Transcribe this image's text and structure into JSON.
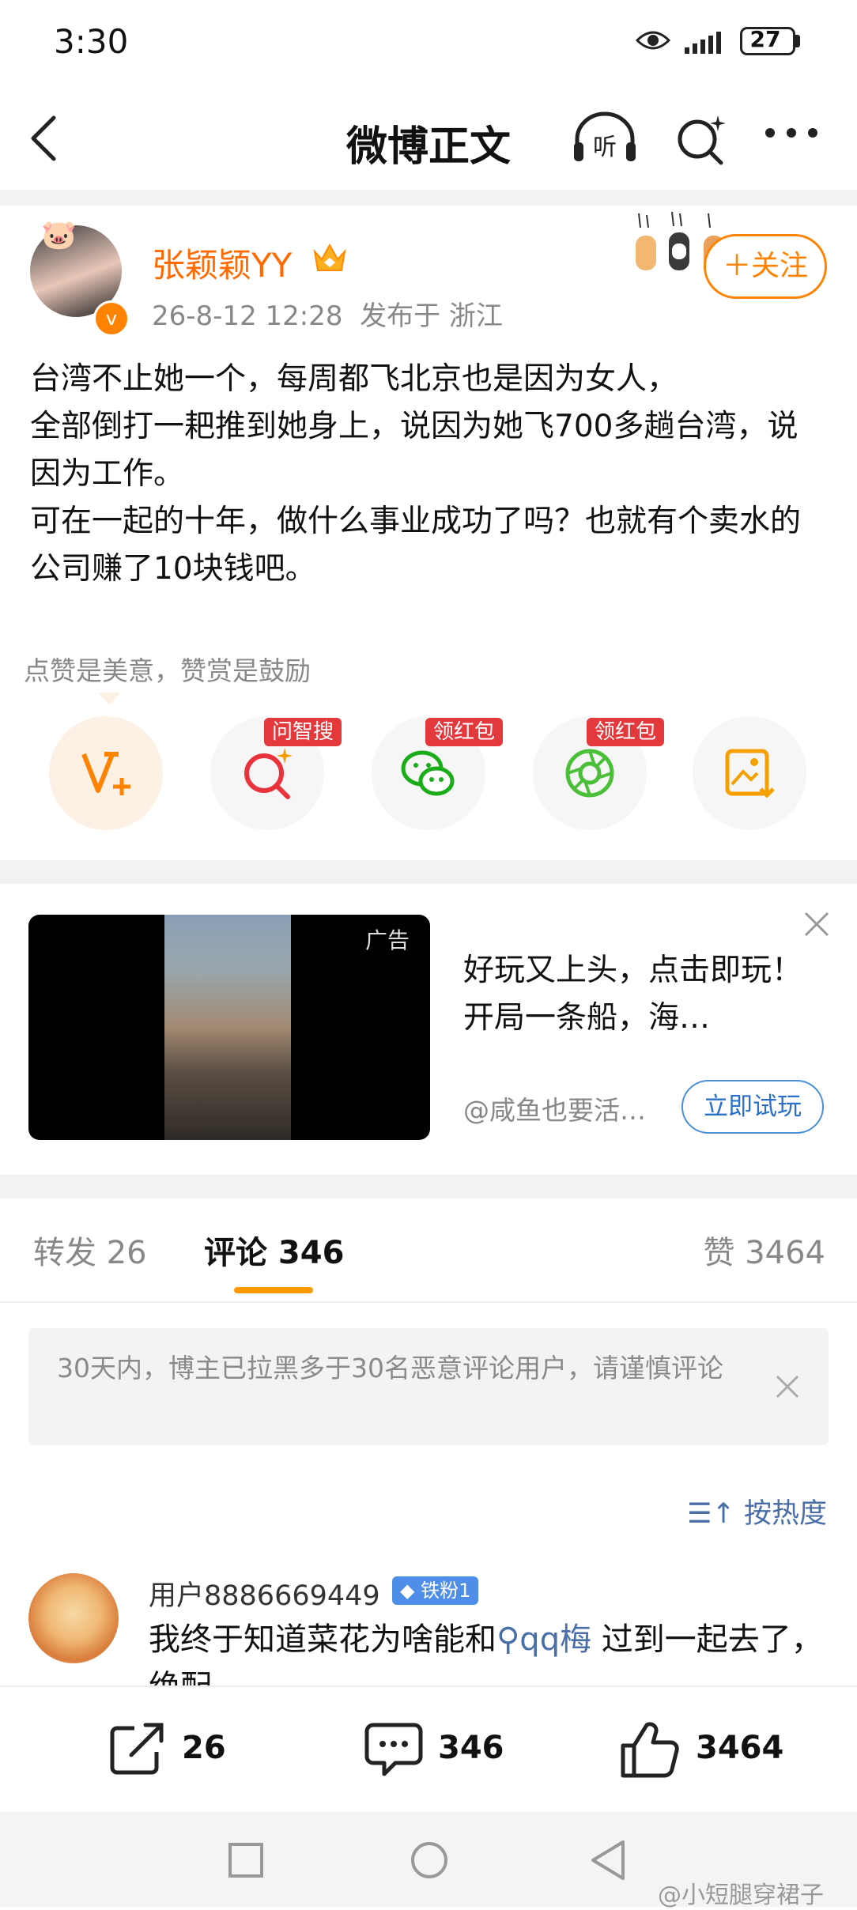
{
  "status_bar": {
    "time": "3:30",
    "battery": "27"
  },
  "nav": {
    "title": "微博正文",
    "listen_label": "听"
  },
  "post": {
    "author": "张颖颖YY",
    "meta": "26-8-12 12:28  发布于 浙江",
    "follow_label": "＋关注",
    "text": "台湾不止她一个，每周都飞北京也是因为女人，\n全部倒打一耙推到她身上，说因为她飞700多趟台湾，说因为工作。\n可在一起的十年，做什么事业成功了吗？也就有个卖水的公司赚了10块钱吧。",
    "tip": "点赞是美意，赞赏是鼓励",
    "actions": [
      {
        "icon": "v-plus-icon",
        "badge": ""
      },
      {
        "icon": "ai-search-icon",
        "badge": "问智搜"
      },
      {
        "icon": "wechat-icon",
        "badge": "领红包"
      },
      {
        "icon": "moments-icon",
        "badge": "领红包"
      },
      {
        "icon": "save-image-icon",
        "badge": ""
      }
    ]
  },
  "ad": {
    "label": "广告",
    "title": "好玩又上头，点击即玩！开局一条船，海…",
    "source": "@咸鱼也要活…",
    "button": "立即试玩"
  },
  "tabs": {
    "repost": "转发 26",
    "comment": "评论 346",
    "like": "赞 3464"
  },
  "notice": "30天内，博主已拉黑多于30名恶意评论用户，请谨慎评论",
  "sort_label": "按热度",
  "comment": {
    "user": "用户8886669449",
    "fan_badge": "铁粉1",
    "text_before": "我终于知道菜花为啥能和",
    "link": "qq梅",
    "text_after": " 过到一起去了，绝配"
  },
  "bottom_bar": {
    "repost": "26",
    "comment": "346",
    "like": "3464"
  },
  "watermark": "@小短腿穿裙子",
  "colors": {
    "accent": "#ff8200",
    "link": "#4a6ea8",
    "badge_red": "#e4393c"
  }
}
